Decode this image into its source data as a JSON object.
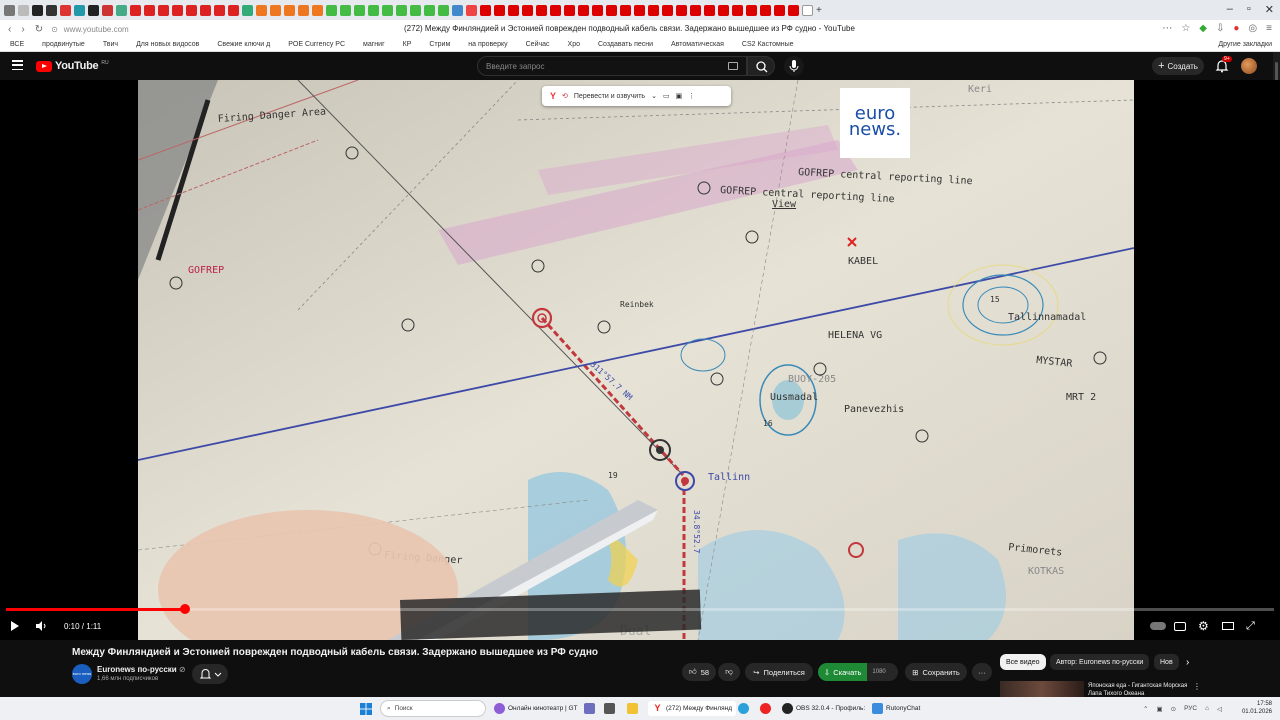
{
  "browser": {
    "url": "www.youtube.com",
    "tab_title": "(272) Между Финляндией и Эстонией поврежден подводный кабель связи. Задержано вышедшее из РФ судно - YouTube",
    "bookmarks": [
      "ВСЕ",
      "продвинутые",
      "Твич",
      "Для новых видосов",
      "Свежие ключи д",
      "POE Currency PC",
      "магниг",
      "КР",
      "Стрим",
      "на проверку",
      "Сейчас",
      "Хро",
      "Создавать песни",
      "Автоматическая",
      "CS2 Кастомные"
    ],
    "other_bookmarks": "Другие закладки"
  },
  "youtube": {
    "logo_text": "YouTube",
    "region": "RU",
    "search_placeholder": "Введите запрос",
    "create_label": "Создать",
    "notifications_count": "9+"
  },
  "overlay": {
    "translate_label": "Перевести и озвучить",
    "euronews_line1": "euro",
    "euronews_line2": "news."
  },
  "player": {
    "time": "0:10 / 1:11",
    "progress_fraction": 0.1408
  },
  "video": {
    "title": "Между Финляндией и Эстонией поврежден подводный кабель связи. Задержано вышедшее из РФ судно",
    "channel_name": "Euronews по-русски",
    "channel_verified": "⊘",
    "subscribers": "1,66 млн подписчиков",
    "channel_avatar_text": "euro news",
    "likes": "58",
    "share_label": "Поделиться",
    "download_label": "Скачать",
    "download_quality": "1080",
    "save_label": "Сохранить",
    "more_label": "···"
  },
  "sidebar": {
    "chips": [
      "Все видео",
      "Автор: Euronews по-русски",
      "Нов"
    ],
    "recommendation_title": "Японская еда - Гигантская Морская Лапа Тихого Океана"
  },
  "taskbar": {
    "search_label": "Поиск",
    "items": [
      "Онлайн кинотеатр | GT",
      "(272) Между Финлянд",
      "OBS 32.0.4 - Профиль:",
      "RutonyChat"
    ],
    "lang": "РУС",
    "time": "17:58",
    "date": "01.01.2026"
  },
  "map": {
    "labels": [
      "Firing Danger Area",
      "GOFREP central reporting line",
      "GOFREP central reporting line",
      "View",
      "KABEL",
      "GOFREP",
      "Reinbek",
      "HELENA VG",
      "Tallinnamadal",
      "MYSTAR",
      "BUOY-205",
      "Uusmadal",
      "Panevezhis",
      "MRT 2",
      "Firing Danger",
      "Primorets",
      "KOTKAS",
      "Dual",
      "Keri",
      "Tallinn",
      "15",
      "16",
      "19",
      "311°57.7 NM",
      "34.8°52.7"
    ]
  },
  "colors": {
    "accent": "#ff0000",
    "download": "#1f8a36",
    "background": "#0f0f0f",
    "map_paper": "#ddd8c8"
  }
}
